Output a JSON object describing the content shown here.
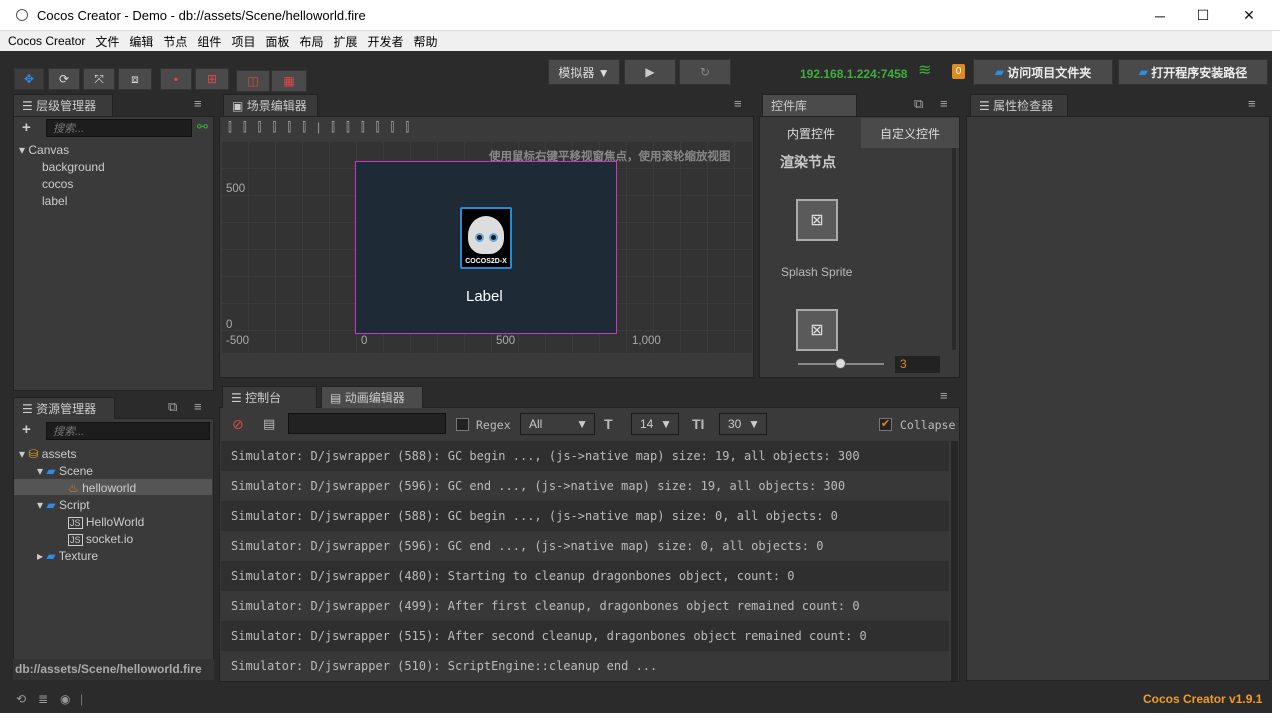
{
  "window": {
    "title": "Cocos Creator - Demo - db://assets/Scene/helloworld.fire",
    "minimize": "─",
    "maximize": "☐",
    "close": "✕"
  },
  "menu": [
    "Cocos Creator",
    "文件",
    "编辑",
    "节点",
    "组件",
    "项目",
    "面板",
    "布局",
    "扩展",
    "开发者",
    "帮助"
  ],
  "toolbar": {
    "device": "模拟器 ▼",
    "ip": "192.168.1.224:7458",
    "badge": "0",
    "open_project_folder": "访问项目文件夹",
    "open_install_path": "打开程序安装路径"
  },
  "hierarchy": {
    "title": "层级管理器",
    "search_placeholder": "搜索...",
    "root": "Canvas",
    "children": [
      "background",
      "cocos",
      "label"
    ]
  },
  "scene": {
    "title": "场景编辑器",
    "hint": "使用鼠标右键平移视窗焦点，使用滚轮缩放视图",
    "y_ticks": [
      "500",
      "0"
    ],
    "x_ticks": [
      "-500",
      "0",
      "500",
      "1,000"
    ],
    "label_text": "Label",
    "logo_text": "COCOS2D-X"
  },
  "widgets": {
    "title": "控件库",
    "tab_builtin": "内置控件",
    "tab_custom": "自定义控件",
    "section": "渲染节点",
    "item1": "Splash Sprite",
    "zoom_value": "3"
  },
  "inspector": {
    "title": "属性检查器"
  },
  "assets": {
    "title": "资源管理器",
    "search_placeholder": "搜索...",
    "root": "assets",
    "scene_folder": "Scene",
    "scene_file": "helloworld",
    "script_folder": "Script",
    "script_files": [
      "HelloWorld",
      "socket.io"
    ],
    "texture_folder": "Texture",
    "footer_path": "db://assets/Scene/helloworld.fire"
  },
  "console": {
    "tab_console": "控制台",
    "tab_animation": "动画编辑器",
    "regex_label": "Regex",
    "level_select": "All",
    "font_size": "14",
    "line_height": "30",
    "collapse_label": "Collapse",
    "logs": [
      "Simulator: D/jswrapper (588): GC begin ..., (js->native map) size: 19, all objects: 300",
      "Simulator: D/jswrapper (596): GC end ..., (js->native map) size: 19, all objects: 300",
      "Simulator: D/jswrapper (588): GC begin ..., (js->native map) size: 0, all objects: 0",
      "Simulator: D/jswrapper (596): GC end ..., (js->native map) size: 0, all objects: 0",
      "Simulator: D/jswrapper (480): Starting to cleanup dragonbones object, count: 0",
      "Simulator: D/jswrapper (499): After first cleanup, dragonbones object remained count: 0",
      "Simulator: D/jswrapper (515): After second cleanup, dragonbones object remained count: 0",
      "Simulator: D/jswrapper (510): ScriptEngine::cleanup end ..."
    ]
  },
  "status": {
    "version": "Cocos Creator v1.9.1"
  },
  "colors": {
    "accent_blue": "#2d8ce8",
    "ip_green": "#3fae3f",
    "badge_orange": "#e08a1e",
    "version_orange": "#f39c25",
    "scene_border": "#c33ac3"
  }
}
